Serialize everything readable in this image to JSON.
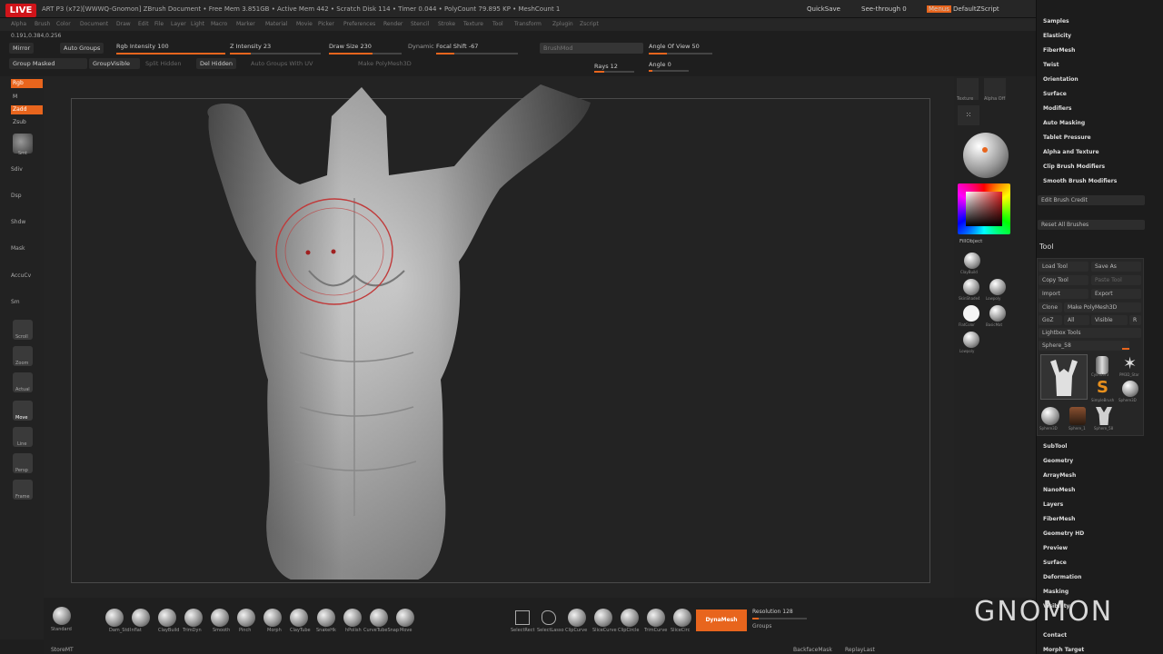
{
  "live_badge": "LIVE",
  "title_info": "ART P3 (x72)[WWWQ-Gnomon]   ZBrush Document   • Free Mem 3.851GB • Active Mem 442 • Scratch Disk 114 • Timer 0.044 • PolyCount 79.895 KP • MeshCount 1",
  "menus": [
    "Alpha",
    "Brush",
    "Color",
    "Document",
    "Draw",
    "Edit",
    "File",
    "Layer",
    "Light",
    "Macro",
    "Marker",
    "Material",
    "Movie",
    "Picker",
    "Preferences",
    "Render",
    "Stencil",
    "Stroke",
    "Texture",
    "Tool",
    "Transform",
    "Zplugin",
    "Zscript"
  ],
  "top_right": {
    "quicksave": "QuickSave",
    "see_through": "See-through  0",
    "menus_btn": "Menus",
    "default_zscript": "DefaultZScript"
  },
  "coords": "0.191,0.384,0.256",
  "toolbar_row1": {
    "mirror": "Mirror",
    "auto_groups": "Auto Groups",
    "rgb_intensity": "Rgb Intensity 100",
    "z_intensity": "Z Intensity 23",
    "draw_size": "Draw Size 230",
    "dynamic": "Dynamic",
    "focal_shift": "Focal Shift -67",
    "brush_mod": "BrushMod",
    "angle_of_view": "Angle Of View 50"
  },
  "toolbar_row2": {
    "group_masked": "Group Masked",
    "group_visible": "GroupVisible",
    "split_hidden": "Split Hidden",
    "del_hidden": "Del Hidden",
    "auto_groups_uv": "Auto Groups With UV",
    "make_pm": "Make PolyMesh3D",
    "rays": "Rays 12",
    "angle": "Angle 0"
  },
  "left_shelf": {
    "rgb": "Rgb",
    "m": "M",
    "zadd": "Zadd",
    "zsub": "Zsub",
    "smt": "Smt",
    "tools": [
      "Sdiv",
      "Dsp",
      "Shdw",
      "Mask",
      "AccuCv",
      "Sm"
    ],
    "icons": [
      "Scroll",
      "Zoom",
      "Actual",
      "Move",
      "Line",
      "Persp",
      "Frame"
    ]
  },
  "right_shelf": {
    "texture": "Texture",
    "alpha": "Alpha Off",
    "fill_object": "FillObject",
    "spheres": [
      "ClayBuild",
      "SkinShade4",
      "Lowpoly",
      "FlatColor",
      "BasicMat",
      "Lowpoly"
    ]
  },
  "palette": {
    "brush_items": [
      "Samples",
      "Elasticity",
      "FiberMesh",
      "Twist",
      "Orientation",
      "Surface",
      "Modifiers",
      "Auto Masking",
      "Tablet Pressure",
      "Alpha and Texture",
      "Clip Brush Modifiers",
      "Smooth Brush Modifiers"
    ],
    "edit_brush_credit": "Edit Brush Credit",
    "reset_all_brushes": "Reset All Brushes",
    "tool_header": "Tool",
    "load_tool": "Load Tool",
    "save_as": "Save As",
    "copy_tool": "Copy Tool",
    "paste_tool": "Paste Tool",
    "import": "Import",
    "export": "Export",
    "clone": "Clone",
    "make_polymesh": "Make PolyMesh3D",
    "goz": "GoZ",
    "all": "All",
    "visible": "Visible",
    "r": "R",
    "lightbox_tools": "Lightbox Tools",
    "sphere_slider": "Sphere_58",
    "thumbs": [
      "Cylinder3",
      "PM3D_Star",
      "SimpleBrush",
      "Sphere3D",
      "Sphere3D",
      "Sphere_1",
      "Sphere_58"
    ],
    "tool_items": [
      "SubTool",
      "Geometry",
      "ArrayMesh",
      "NanoMesh",
      "Layers",
      "FiberMesh",
      "Geometry HD",
      "Preview",
      "Surface",
      "Deformation",
      "Masking",
      "Visibility",
      "Contact",
      "Morph Target"
    ]
  },
  "bottom": {
    "brushes": [
      "Standard",
      "Dam_Std",
      "Inflat",
      "ClayBuild",
      "TrimDyn",
      "Smooth",
      "Pinch",
      "Morph",
      "ClayTube",
      "SnakeHk",
      "hPolish",
      "CurveTubeSnap",
      "Move"
    ],
    "clip_tools": [
      "SelectRect",
      "SelectLasso",
      "ClipCurve",
      "SliceCurve",
      "ClipCircle",
      "TrimCurve",
      "SliceCirc"
    ],
    "dynamesh": "DynaMesh",
    "resolution": "Resolution 128",
    "groups": "Groups",
    "store_mt": "StoreMT",
    "backface_mask": "BackfaceMask",
    "replay_last": "ReplayLast"
  },
  "watermark": "GNOMON"
}
